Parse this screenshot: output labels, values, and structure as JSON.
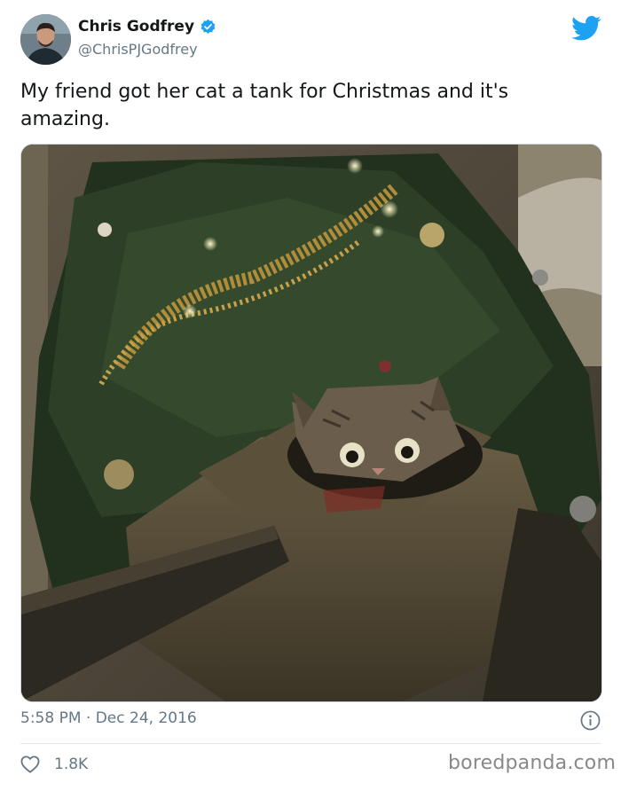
{
  "author": {
    "display_name": "Chris Godfrey",
    "handle": "@ChrisPJGodfrey",
    "verified": true
  },
  "tweet": {
    "text": "My friend got her cat a tank for Christmas and it's amazing.",
    "timestamp": "5:58 PM · Dec 24, 2016",
    "like_count": "1.8K"
  },
  "media": {
    "alt": "Kitten peeking out of a cardboard tank under a Christmas tree"
  },
  "watermark": "boredpanda.com",
  "colors": {
    "brand": "#1da1f2",
    "text": "#14171a",
    "secondary": "#657786",
    "divider": "#e1e8ed"
  },
  "icons": {
    "logo": "twitter-bird-icon",
    "verified": "verified-badge-icon",
    "info": "info-icon",
    "like": "heart-icon"
  }
}
